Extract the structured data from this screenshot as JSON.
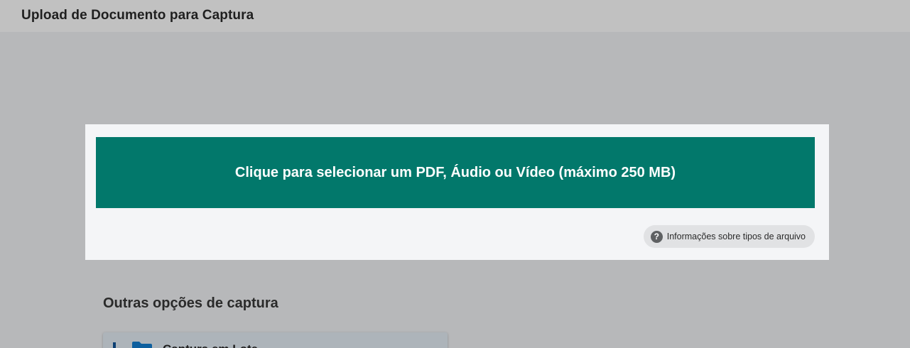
{
  "header": {
    "title": "Upload de Documento para Captura"
  },
  "upload": {
    "button_label": "Clique para selecionar um PDF, Áudio ou Vídeo (máximo 250 MB)",
    "info_label": "Informações sobre tipos de arquivo",
    "info_icon": "help-circle-icon"
  },
  "other_options": {
    "title": "Outras opções de captura",
    "items": [
      {
        "label": "Captura em Lote",
        "icon": "folder-icon"
      }
    ]
  },
  "colors": {
    "accent": "#02786b",
    "folder": "#0d5f9e"
  }
}
